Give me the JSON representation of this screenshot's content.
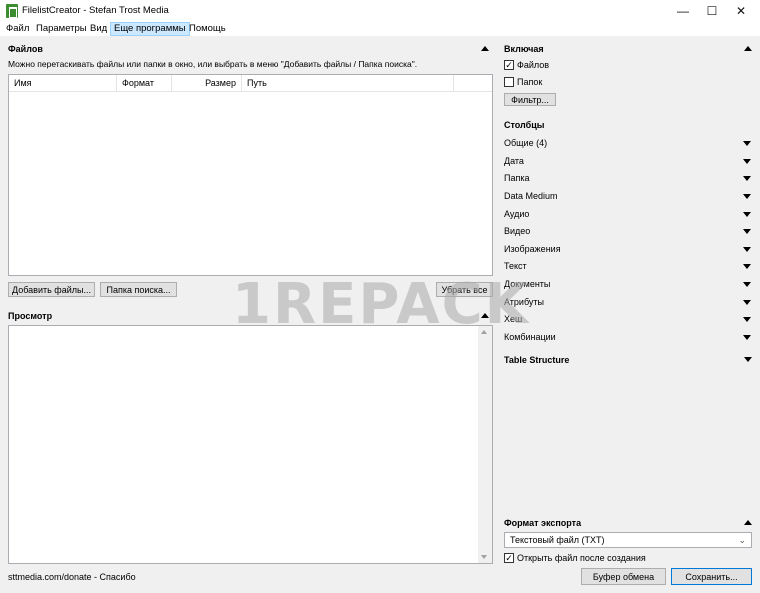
{
  "window": {
    "title": "FilelistCreator - Stefan Trost Media"
  },
  "menu": [
    "Файл",
    "Параметры",
    "Вид",
    "Еще программы",
    "Помощь"
  ],
  "files": {
    "title": "Файлов",
    "hint": "Можно перетаскивать файлы или папки в окно, или выбрать в меню \"Добавить файлы / Папка поиска\".",
    "columns": [
      "Имя",
      "Формат",
      "Размер",
      "Путь"
    ],
    "add_files_button": "Добавить файлы...",
    "search_folder_button": "Папка поиска...",
    "clear_button": "Убрать все"
  },
  "preview": {
    "title": "Просмотр"
  },
  "status": {
    "text": "sttmedia.com/donate - Спасибо"
  },
  "include": {
    "title": "Включая",
    "files_label": "Файлов",
    "files_checked": true,
    "folders_label": "Папок",
    "folders_checked": false,
    "filter_button": "Фильтр..."
  },
  "columns_section": {
    "title": "Столбцы",
    "items": [
      "Общие (4)",
      "Дата",
      "Папка",
      "Data Medium",
      "Аудио",
      "Видео",
      "Изображения",
      "Текст",
      "Документы",
      "Атрибуты",
      "Хеш",
      "Комбинации"
    ]
  },
  "table_structure": {
    "title": "Table Structure"
  },
  "export": {
    "title": "Формат экспорта",
    "format_value": "Текстовый файл (TXT)",
    "open_after_label": "Открыть файл после создания",
    "open_after_checked": true,
    "clipboard_button": "Буфер обмена",
    "save_button": "Сохранить..."
  },
  "watermark": "1REPACK",
  "icons": {
    "app": "filelist-app-icon",
    "minimize": "minimize-icon",
    "maximize": "maximize-icon",
    "close": "close-icon"
  }
}
